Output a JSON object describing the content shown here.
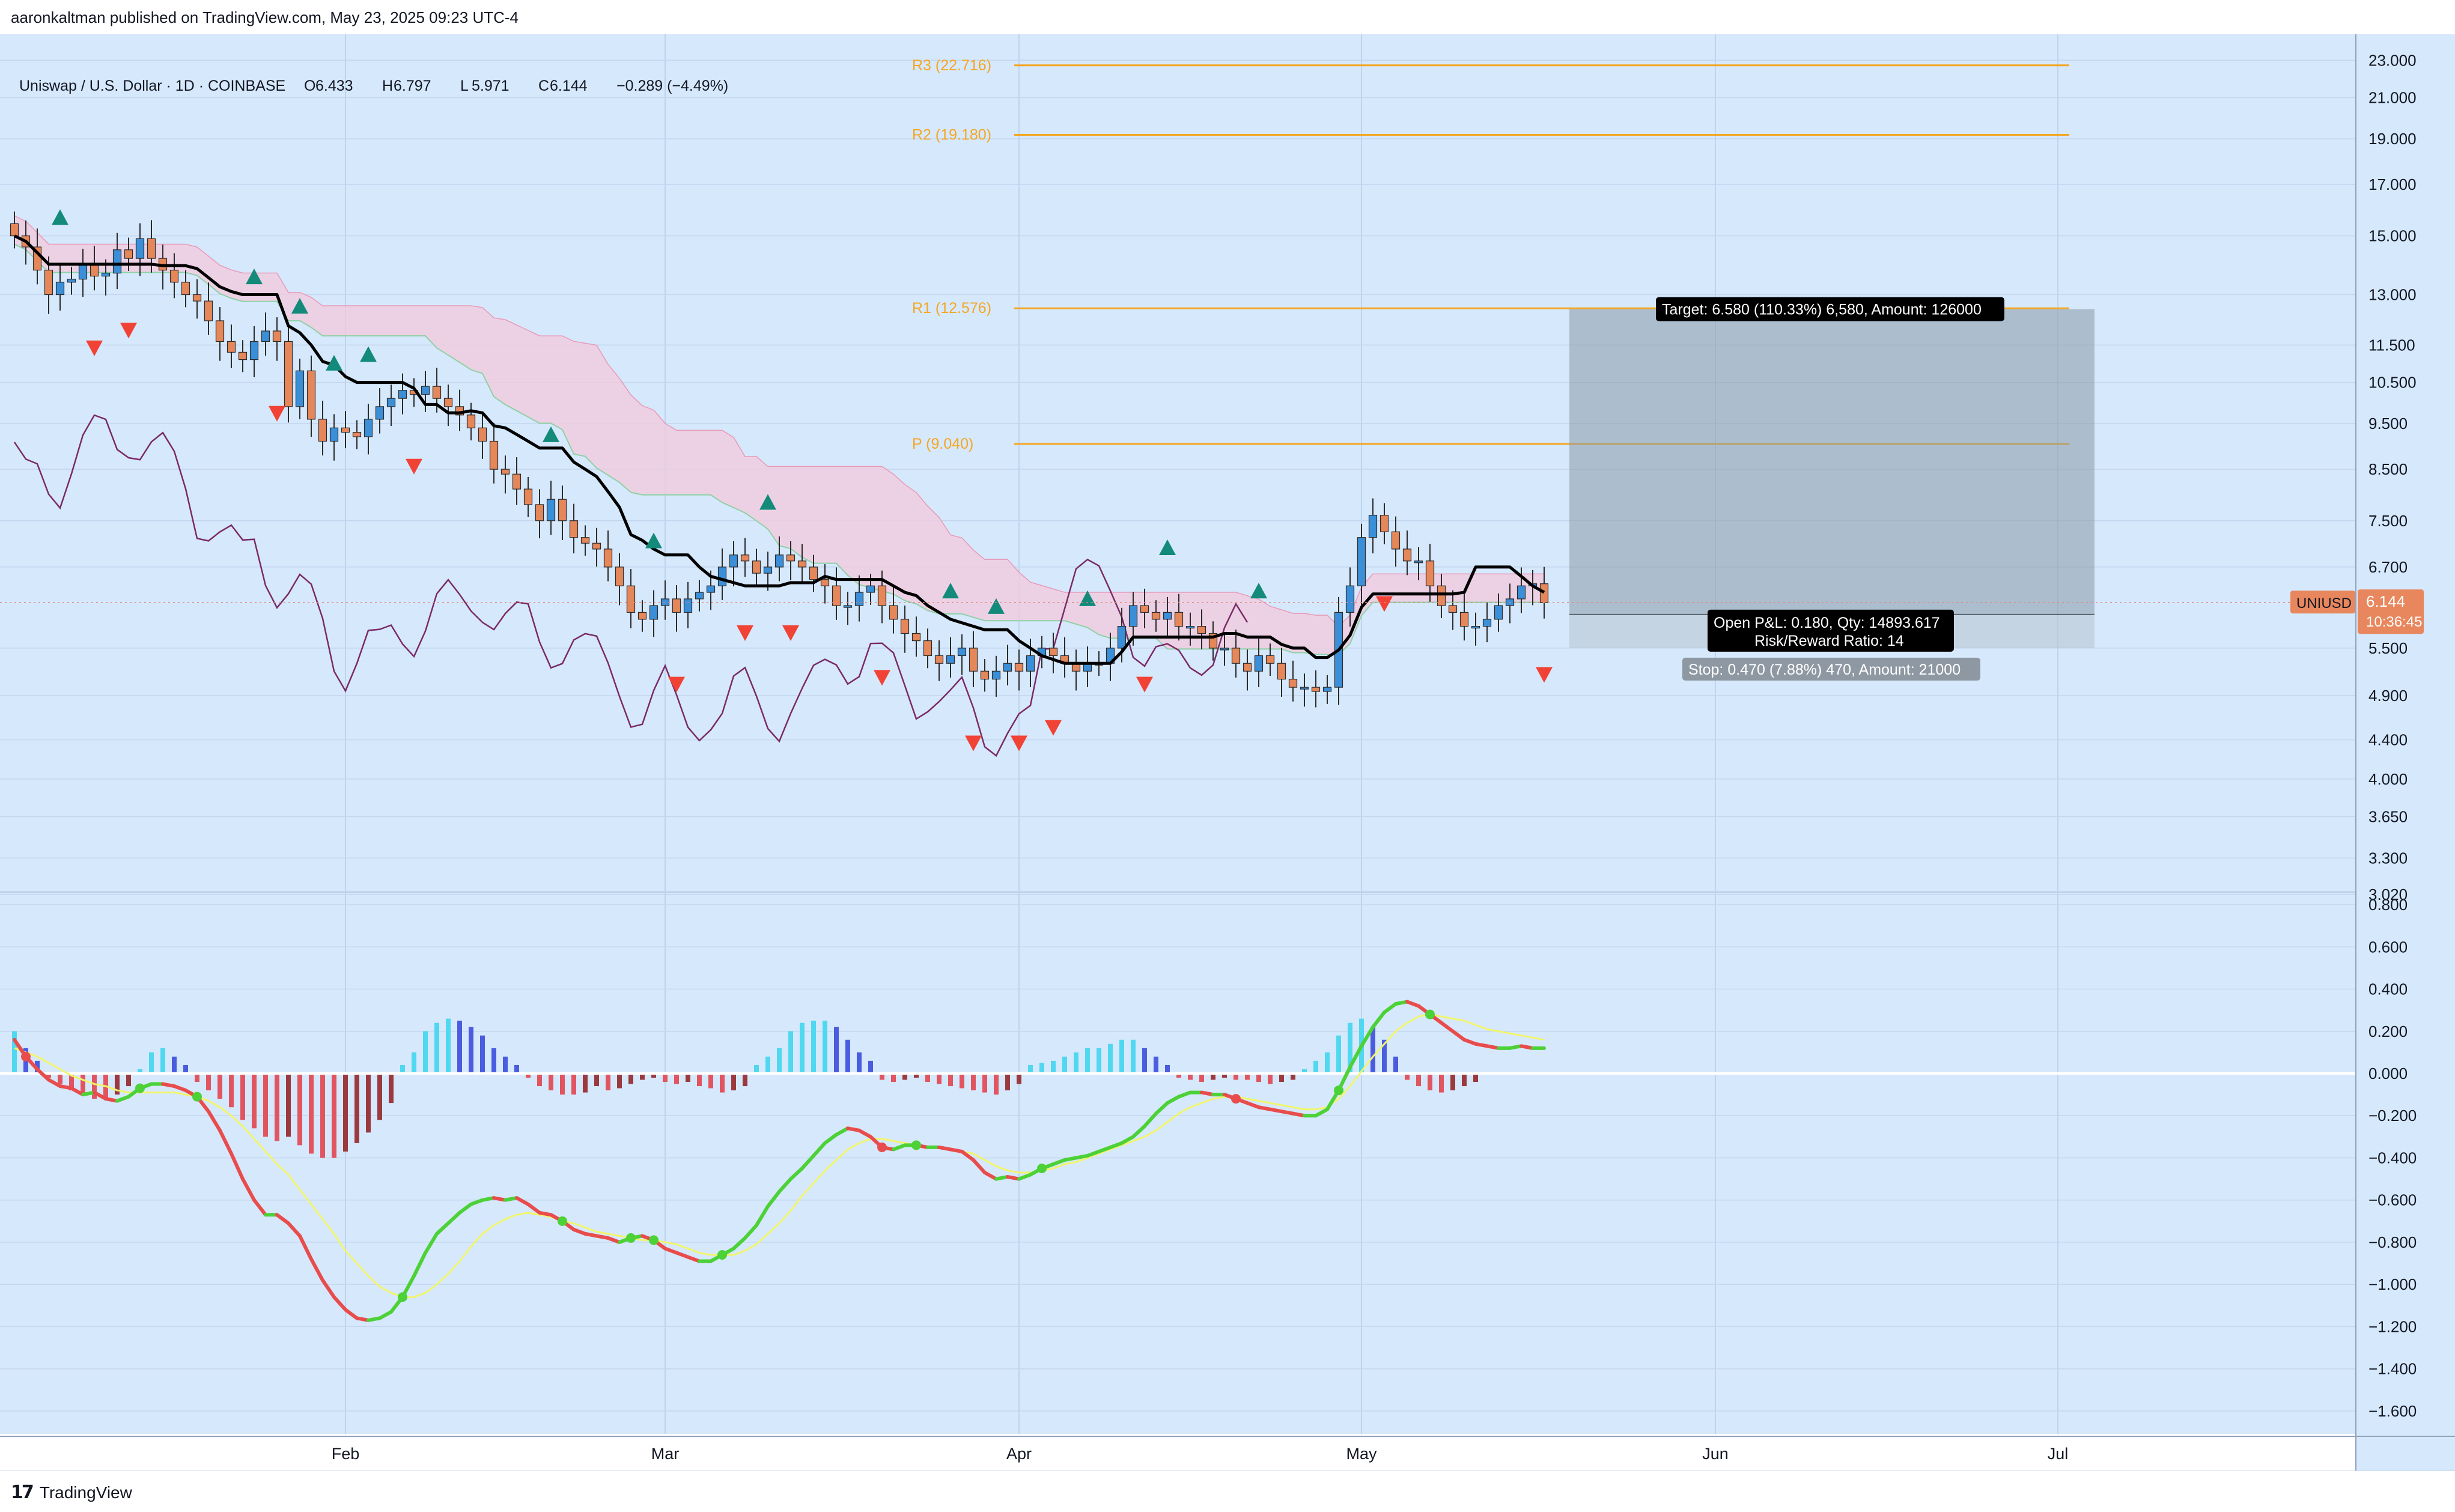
{
  "header": {
    "publisher": "aaronkaltman published on TradingView.com, May 23, 2025 09:23 UTC-4"
  },
  "legend": {
    "symbol": "Uniswap / U.S. Dollar · 1D · COINBASE",
    "open_label": "O",
    "open": "6.433",
    "high_label": "H",
    "high": "6.797",
    "low_label": "L",
    "low": "5.971",
    "close_label": "C",
    "close": "6.144",
    "change": "−0.289 (−4.49%)"
  },
  "price_tag": {
    "symbol": "UNIUSD",
    "price": "6.144",
    "countdown": "10:36:45"
  },
  "pivots": [
    {
      "label": "R3 (22.716)",
      "value": 22.716
    },
    {
      "label": "R2 (19.180)",
      "value": 19.18
    },
    {
      "label": "R1 (12.576)",
      "value": 12.576
    },
    {
      "label": "P (9.040)",
      "value": 9.04
    }
  ],
  "position": {
    "target_label": "Target: 6.580 (110.33%) 6,580, Amount: 126000",
    "pnl_label": "Open P&L: 0.180, Qty: 14893.617",
    "rr_label": "Risk/Reward Ratio: 14",
    "stop_label": "Stop: 0.470 (7.88%) 470, Amount: 21000",
    "entry": 5.97,
    "target": 12.55,
    "stop": 5.5
  },
  "colors": {
    "background": "#d6e8fc",
    "up": "#3a8fd8",
    "down": "#e6875a",
    "pivot": "#f5a623",
    "cloud_bear": "#f3c9dc",
    "cloud_bull": "#b6e3c6",
    "baseline": "#000000",
    "lagging": "#7a2a66",
    "buy_signal": "#138a7a",
    "sell_signal": "#f04336",
    "macd_rise": "#4cd137",
    "macd_fall": "#e84c4c",
    "macd_signal": "#f1f56b",
    "price_tag": "#e8875d"
  },
  "footer": {
    "brand": "TradingView",
    "logo": "17"
  },
  "chart_data": [
    {
      "type": "candlestick",
      "name": "UNIUSD price",
      "scale": "log",
      "ylim": [
        3.02,
        23.9
      ],
      "y_ticks": [
        "23.000",
        "21.000",
        "19.000",
        "17.000",
        "15.000",
        "13.000",
        "11.500",
        "10.500",
        "9.500",
        "8.500",
        "7.500",
        "6.700",
        "6.144",
        "5.500",
        "4.900",
        "4.400",
        "4.000",
        "3.650",
        "3.300",
        "3.020"
      ],
      "x_ticks": [
        "Feb",
        "Mar",
        "Apr",
        "May",
        "Jun",
        "Jul"
      ],
      "x_range_days": [
        0,
        178
      ],
      "month_starts": {
        "Feb": 29,
        "Mar": 57,
        "Apr": 88,
        "May": 118,
        "Jun": 149,
        "Jul": 179
      },
      "candles_close": [
        15.0,
        14.6,
        13.8,
        13.0,
        13.4,
        13.5,
        14.0,
        13.6,
        13.7,
        14.5,
        14.2,
        14.9,
        14.2,
        13.8,
        13.4,
        13.0,
        12.8,
        12.2,
        11.6,
        11.3,
        11.1,
        11.6,
        11.9,
        11.6,
        9.9,
        10.8,
        9.6,
        9.1,
        9.4,
        9.3,
        9.2,
        9.6,
        9.9,
        10.1,
        10.3,
        10.2,
        10.4,
        10.1,
        9.9,
        9.7,
        9.4,
        9.1,
        8.5,
        8.4,
        8.1,
        7.8,
        7.5,
        7.9,
        7.5,
        7.2,
        7.1,
        7.0,
        6.7,
        6.4,
        6.0,
        5.9,
        6.1,
        6.2,
        6.0,
        6.2,
        6.3,
        6.4,
        6.7,
        6.9,
        6.8,
        6.6,
        6.7,
        6.9,
        6.8,
        6.7,
        6.5,
        6.4,
        6.1,
        6.1,
        6.3,
        6.4,
        6.1,
        5.9,
        5.7,
        5.6,
        5.4,
        5.3,
        5.4,
        5.5,
        5.2,
        5.1,
        5.2,
        5.3,
        5.2,
        5.4,
        5.5,
        5.4,
        5.3,
        5.2,
        5.3,
        5.3,
        5.5,
        5.8,
        6.1,
        6.0,
        5.9,
        6.0,
        5.8,
        5.8,
        5.7,
        5.5,
        5.5,
        5.3,
        5.2,
        5.4,
        5.3,
        5.1,
        5.0,
        5.0,
        4.95,
        5.0,
        6.0,
        6.4,
        7.2,
        7.6,
        7.3,
        7.0,
        6.8,
        6.8,
        6.4,
        6.1,
        6.0,
        5.8,
        5.8,
        5.9,
        6.1,
        6.2,
        6.4,
        6.433,
        6.144
      ]
    },
    {
      "type": "line",
      "name": "MACD",
      "ylim": [
        -1.72,
        0.86
      ],
      "y_ticks": [
        "0.800",
        "0.600",
        "0.400",
        "0.200",
        "0.000",
        "−0.200",
        "−0.400",
        "−0.600",
        "−0.800",
        "−1.000",
        "−1.200",
        "−1.400",
        "−1.600"
      ],
      "macd": [
        0.16,
        0.08,
        0.02,
        -0.03,
        -0.06,
        -0.07,
        -0.1,
        -0.09,
        -0.12,
        -0.13,
        -0.11,
        -0.07,
        -0.05,
        -0.05,
        -0.06,
        -0.08,
        -0.11,
        -0.18,
        -0.27,
        -0.38,
        -0.5,
        -0.6,
        -0.67,
        -0.67,
        -0.71,
        -0.77,
        -0.88,
        -0.98,
        -1.06,
        -1.12,
        -1.16,
        -1.17,
        -1.16,
        -1.13,
        -1.06,
        -0.96,
        -0.85,
        -0.76,
        -0.71,
        -0.66,
        -0.62,
        -0.6,
        -0.59,
        -0.6,
        -0.59,
        -0.62,
        -0.66,
        -0.67,
        -0.7,
        -0.74,
        -0.76,
        -0.77,
        -0.78,
        -0.8,
        -0.78,
        -0.77,
        -0.79,
        -0.83,
        -0.85,
        -0.87,
        -0.89,
        -0.89,
        -0.86,
        -0.83,
        -0.78,
        -0.72,
        -0.63,
        -0.56,
        -0.5,
        -0.45,
        -0.39,
        -0.33,
        -0.29,
        -0.26,
        -0.27,
        -0.3,
        -0.35,
        -0.36,
        -0.34,
        -0.34,
        -0.35,
        -0.35,
        -0.36,
        -0.37,
        -0.41,
        -0.47,
        -0.5,
        -0.49,
        -0.5,
        -0.48,
        -0.45,
        -0.43,
        -0.41,
        -0.4,
        -0.39,
        -0.37,
        -0.35,
        -0.33,
        -0.3,
        -0.25,
        -0.19,
        -0.14,
        -0.11,
        -0.09,
        -0.09,
        -0.1,
        -0.1,
        -0.12,
        -0.14,
        -0.16,
        -0.17,
        -0.18,
        -0.19,
        -0.2,
        -0.2,
        -0.17,
        -0.08,
        0.03,
        0.13,
        0.22,
        0.29,
        0.33,
        0.34,
        0.32,
        0.28,
        0.24,
        0.2,
        0.16,
        0.14,
        0.13,
        0.12,
        0.12,
        0.13,
        0.12,
        0.12
      ],
      "signal": [
        0.12,
        0.1,
        0.08,
        0.05,
        0.02,
        -0.01,
        -0.03,
        -0.05,
        -0.06,
        -0.08,
        -0.09,
        -0.09,
        -0.09,
        -0.09,
        -0.09,
        -0.1,
        -0.11,
        -0.13,
        -0.16,
        -0.2,
        -0.25,
        -0.31,
        -0.37,
        -0.43,
        -0.48,
        -0.55,
        -0.62,
        -0.69,
        -0.76,
        -0.84,
        -0.9,
        -0.96,
        -1.01,
        -1.04,
        -1.06,
        -1.06,
        -1.04,
        -1.0,
        -0.95,
        -0.89,
        -0.82,
        -0.76,
        -0.72,
        -0.69,
        -0.67,
        -0.66,
        -0.67,
        -0.68,
        -0.7,
        -0.71,
        -0.73,
        -0.75,
        -0.76,
        -0.77,
        -0.78,
        -0.79,
        -0.79,
        -0.8,
        -0.81,
        -0.83,
        -0.85,
        -0.86,
        -0.86,
        -0.86,
        -0.84,
        -0.81,
        -0.76,
        -0.71,
        -0.65,
        -0.58,
        -0.52,
        -0.46,
        -0.41,
        -0.36,
        -0.33,
        -0.31,
        -0.31,
        -0.32,
        -0.33,
        -0.34,
        -0.35,
        -0.35,
        -0.36,
        -0.37,
        -0.38,
        -0.41,
        -0.44,
        -0.46,
        -0.47,
        -0.47,
        -0.46,
        -0.45,
        -0.43,
        -0.42,
        -0.4,
        -0.38,
        -0.36,
        -0.34,
        -0.32,
        -0.3,
        -0.27,
        -0.23,
        -0.19,
        -0.16,
        -0.14,
        -0.12,
        -0.11,
        -0.11,
        -0.12,
        -0.13,
        -0.14,
        -0.15,
        -0.16,
        -0.17,
        -0.17,
        -0.16,
        -0.12,
        -0.06,
        0.01,
        0.08,
        0.14,
        0.2,
        0.24,
        0.27,
        0.28,
        0.27,
        0.26,
        0.25,
        0.23,
        0.21,
        0.2,
        0.19,
        0.18,
        0.17,
        0.16
      ],
      "histogram": [
        0.2,
        0.12,
        0.06,
        -0.02,
        -0.05,
        -0.08,
        -0.1,
        -0.12,
        -0.12,
        -0.1,
        -0.06,
        0.02,
        0.1,
        0.12,
        0.08,
        0.04,
        -0.04,
        -0.08,
        -0.12,
        -0.16,
        -0.22,
        -0.26,
        -0.3,
        -0.32,
        -0.3,
        -0.34,
        -0.38,
        -0.4,
        -0.4,
        -0.37,
        -0.33,
        -0.28,
        -0.22,
        -0.14,
        0.04,
        0.1,
        0.2,
        0.24,
        0.26,
        0.25,
        0.22,
        0.18,
        0.12,
        0.08,
        0.04,
        -0.02,
        -0.06,
        -0.08,
        -0.1,
        -0.1,
        -0.09,
        -0.06,
        -0.08,
        -0.07,
        -0.05,
        -0.03,
        -0.02,
        -0.04,
        -0.05,
        -0.04,
        -0.06,
        -0.07,
        -0.09,
        -0.08,
        -0.06,
        0.04,
        0.08,
        0.12,
        0.2,
        0.24,
        0.25,
        0.25,
        0.22,
        0.16,
        0.1,
        0.06,
        -0.03,
        -0.04,
        -0.03,
        -0.02,
        -0.04,
        -0.05,
        -0.06,
        -0.07,
        -0.08,
        -0.09,
        -0.1,
        -0.08,
        -0.05,
        0.04,
        0.05,
        0.06,
        0.08,
        0.1,
        0.12,
        0.12,
        0.14,
        0.16,
        0.16,
        0.12,
        0.08,
        0.04,
        -0.02,
        -0.03,
        -0.04,
        -0.03,
        -0.02,
        -0.03,
        -0.03,
        -0.04,
        -0.05,
        -0.04,
        -0.03,
        0.02,
        0.06,
        0.1,
        0.18,
        0.24,
        0.26,
        0.22,
        0.16,
        0.08,
        -0.03,
        -0.06,
        -0.08,
        -0.09,
        -0.08,
        -0.06,
        -0.04
      ]
    }
  ]
}
